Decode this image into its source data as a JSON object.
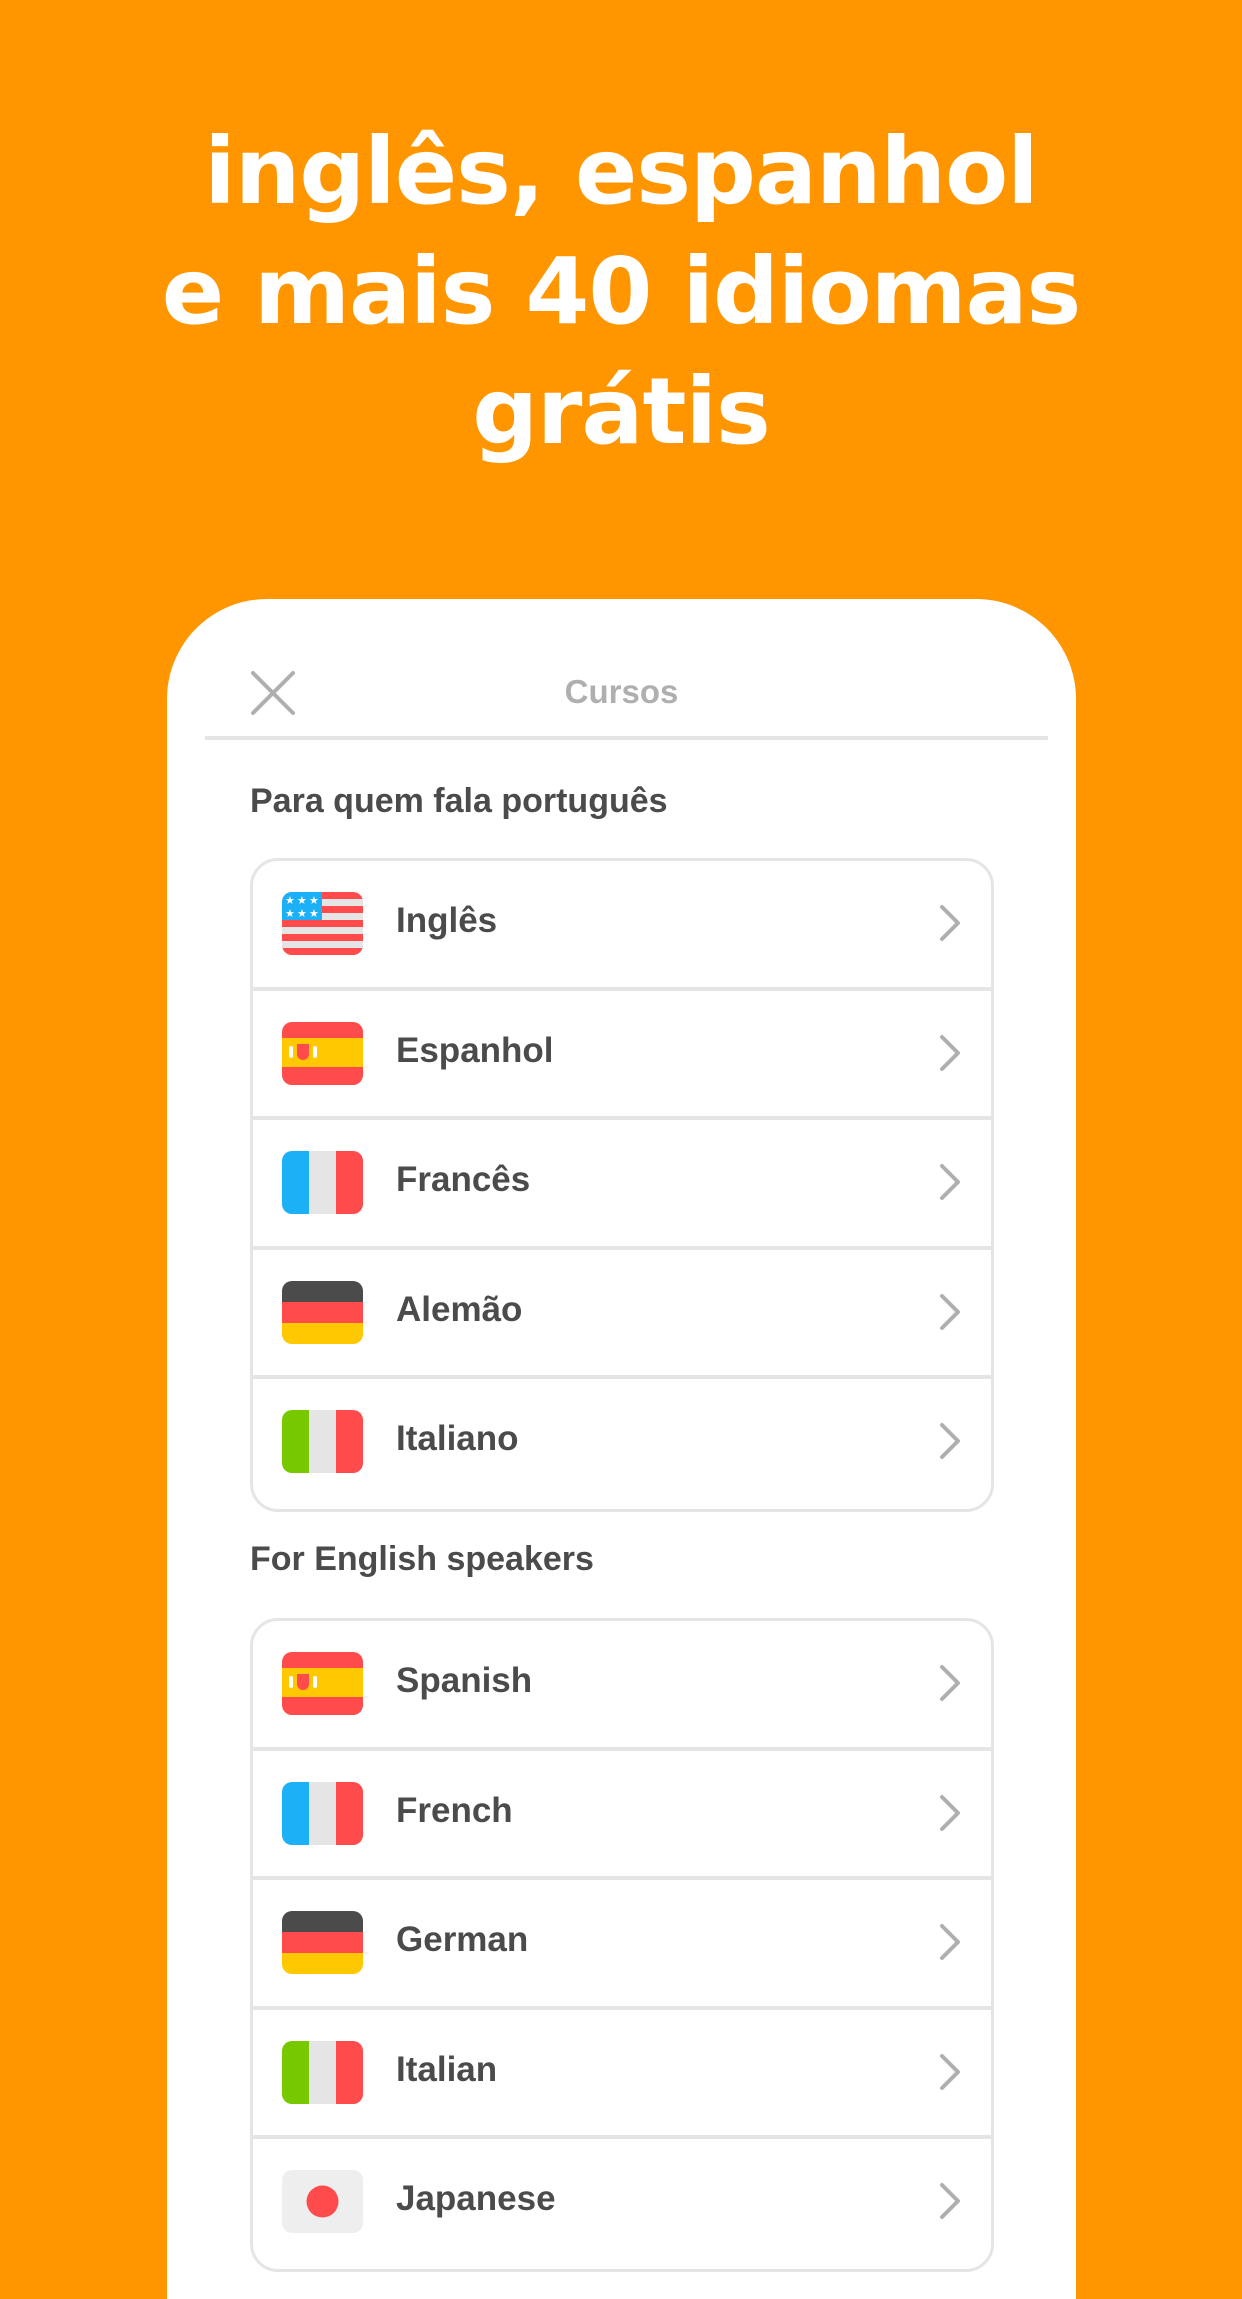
{
  "headline": {
    "lines": [
      "inglês, espanhol",
      "e mais 40 idiomas",
      "grátis"
    ]
  },
  "colors": {
    "background": "#ff9600",
    "card": "#ffffff",
    "text_primary": "#4b4b4b",
    "text_muted": "#afafaf",
    "border": "#e5e5e5"
  },
  "header": {
    "close_icon": "close-icon",
    "title": "Cursos"
  },
  "sections": [
    {
      "title": "Para quem fala português",
      "courses": [
        {
          "label": "Inglês",
          "flag": "us"
        },
        {
          "label": "Espanhol",
          "flag": "es"
        },
        {
          "label": "Francês",
          "flag": "fr"
        },
        {
          "label": "Alemão",
          "flag": "de"
        },
        {
          "label": "Italiano",
          "flag": "it"
        }
      ]
    },
    {
      "title": "For English speakers",
      "courses": [
        {
          "label": "Spanish",
          "flag": "es"
        },
        {
          "label": "French",
          "flag": "fr"
        },
        {
          "label": "German",
          "flag": "de"
        },
        {
          "label": "Italian",
          "flag": "it"
        },
        {
          "label": "Japanese",
          "flag": "jp"
        }
      ]
    }
  ]
}
